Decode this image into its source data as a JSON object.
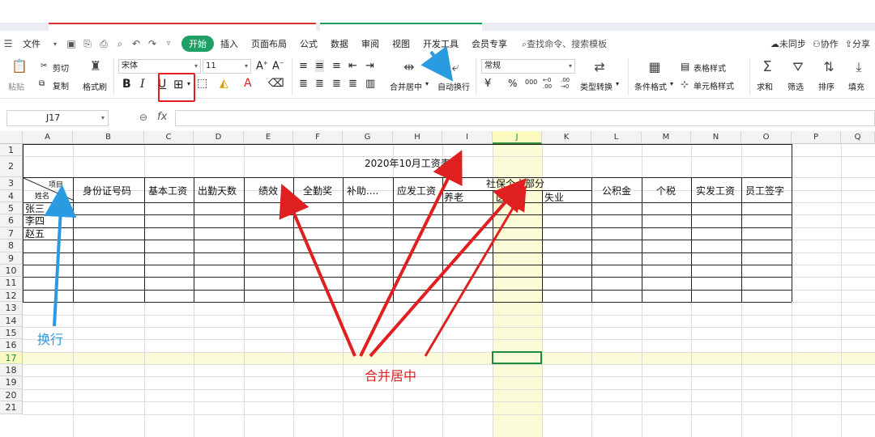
{
  "menubar": {
    "file": "文件",
    "tabs": [
      "开始",
      "插入",
      "页面布局",
      "公式",
      "数据",
      "审阅",
      "视图",
      "开发工具",
      "会员专享"
    ],
    "active_tab": "开始",
    "search": "查找命令、搜索模板",
    "sync": "未同步",
    "collab": "协作",
    "share": "分享"
  },
  "ribbon": {
    "paste": "粘贴",
    "cut": "剪切",
    "copy": "复制",
    "format_painter": "格式刷",
    "font_name": "宋体",
    "font_size": "11",
    "merge_center": "合并居中",
    "wrap_text": "自动换行",
    "number_format": "常规",
    "type_convert": "类型转换",
    "conditional_format": "条件格式",
    "table_style": "表格样式",
    "cell_style": "单元格样式",
    "sum": "求和",
    "filter": "筛选",
    "sort": "排序",
    "fill": "填充",
    "number_symbols": [
      "¥",
      "%",
      "000",
      "←0 .00",
      ".00 →0"
    ]
  },
  "formula_bar": {
    "cell_ref": "J17",
    "fx": "fx",
    "content": ""
  },
  "sheet": {
    "columns": [
      "A",
      "B",
      "C",
      "D",
      "E",
      "F",
      "G",
      "H",
      "I",
      "J",
      "K",
      "L",
      "M",
      "N",
      "O",
      "P",
      "Q"
    ],
    "selected_column": "J",
    "rows": [
      "1",
      "2",
      "3",
      "4",
      "5",
      "6",
      "7",
      "8",
      "9",
      "10",
      "11",
      "12",
      "13",
      "14",
      "15",
      "16",
      "17",
      "18",
      "19",
      "20",
      "21"
    ],
    "selected_row": "17",
    "title": "2020年10月工资表",
    "header_item": "项目",
    "header_name": "姓名",
    "headers": {
      "id": "身份证号码",
      "base": "基本工资",
      "days": "出勤天数",
      "perf": "绩效",
      "attend": "全勤奖",
      "subsidy": "补助....",
      "gross": "应发工资",
      "social": "社保个人部分",
      "pension": "养老",
      "medical": "医疗",
      "unemploy": "失业",
      "fund": "公积金",
      "tax": "个税",
      "net": "实发工资",
      "sign": "员工签字"
    },
    "names": [
      "张三",
      "李四",
      "赵五"
    ]
  },
  "annotations": {
    "wrap": "换行",
    "merge": "合并居中"
  },
  "colors": {
    "accent": "#1ea064",
    "arrow_red": "#e02020",
    "arrow_blue": "#2a9be0"
  }
}
